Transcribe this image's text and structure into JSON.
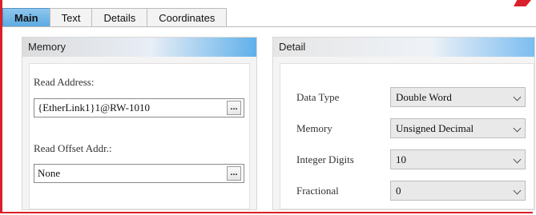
{
  "tabs": [
    {
      "label": "Main"
    },
    {
      "label": "Text"
    },
    {
      "label": "Details"
    },
    {
      "label": "Coordinates"
    }
  ],
  "memory": {
    "title": "Memory",
    "read_address_label": "Read Address:",
    "read_address_value": "{EtherLink1}1@RW-1010",
    "read_offset_label": "Read Offset Addr.:",
    "read_offset_value": "None",
    "browse_label": "..."
  },
  "detail": {
    "title": "Detail",
    "rows": [
      {
        "label": "Data Type",
        "value": "Double Word"
      },
      {
        "label": "Memory",
        "value": "Unsigned Decimal"
      },
      {
        "label": "Integer Digits",
        "value": "10"
      },
      {
        "label": "Fractional",
        "value": "0"
      }
    ]
  },
  "colors": {
    "accent_red": "#d9202a",
    "tab_active": "#5aa8e0"
  }
}
